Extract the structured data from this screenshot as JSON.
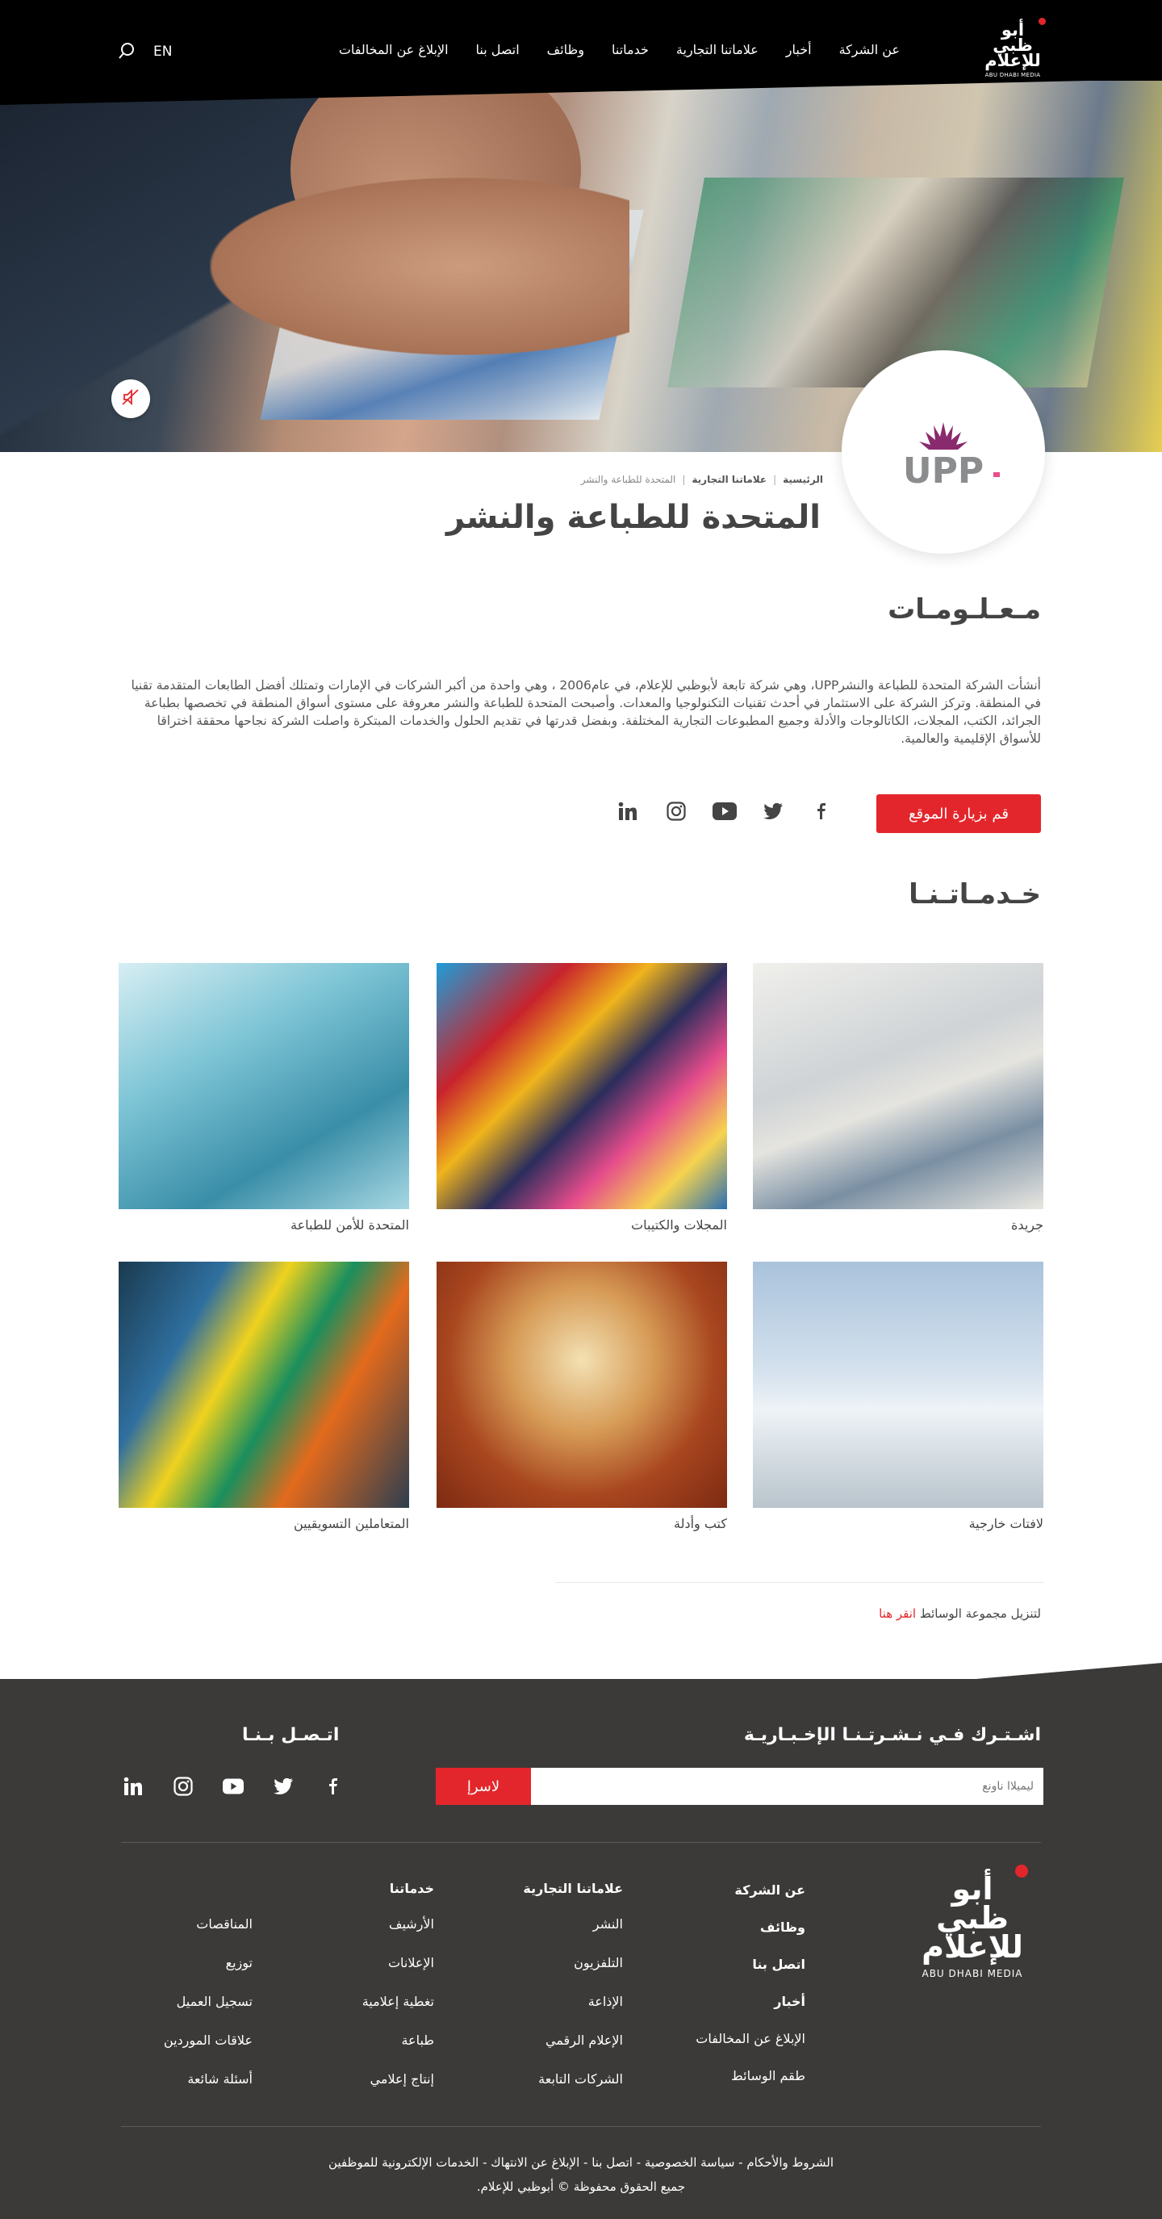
{
  "header": {
    "logo_text": "أبو ظبي للإعلام",
    "logo_sub": "ABU DHABI MEDIA",
    "nav": [
      "عن الشركة",
      "أخبار",
      "علاماتنا التجارية",
      "خدماتنا",
      "وظائف",
      "اتصل بنا",
      "الإبلاغ عن المخالفات"
    ],
    "lang": "EN"
  },
  "brand": {
    "logo_text": "UPP"
  },
  "breadcrumb": [
    "الرئيسية",
    "علاماتنا التجارية",
    "المتحدة للطباعة والنشر"
  ],
  "page_title": "المتحدة للطباعة والنشر",
  "info": {
    "heading": "مـعـلـومـات",
    "text": "أنشأت الشركة المتحدة للطباعة والنشرUPP، وهي شركة تابعة لأبوظبي للإعلام، في عام2006 ، وهي واحدة من أكبر الشركات في الإمارات وتمتلك أفضل الطابعات المتقدمة تقنيا في المنطقة. وتركز الشركة على الاستثمار في أحدث تقنيات التكنولوجيا والمعدات. وأصبحت المتحدة للطباعة والنشر معروفة على مستوى أسواق المنطقة في تخصصها بطباعة الجرائد، الكتب، المجلات، الكاتالوجات والأدلة وجميع المطبوعات التجارية المختلفة. وبفضل قدرتها في تقديم الحلول والخدمات المبتكرة واصلت الشركة نجاحها محققة اختراقا للأسواق الإقليمية والعالمية.",
    "visit_button": "قم بزيارة الموقع"
  },
  "services": {
    "heading": "خـدمـاتـنـا",
    "items": [
      "جريدة",
      "المجلات والكتيبات",
      "المتحدة للأمن للطباعة",
      "لافتات خارجية",
      "كتب وأدلة",
      "المتعاملين التسويقيين"
    ]
  },
  "media_kit": {
    "text": "لتنزيل مجموعة الوسائط",
    "link": "انقر هنا"
  },
  "footer": {
    "newsletter_title": "اشـتـرك فـي نـشـرتـنـا الإخـبـاريـة",
    "newsletter_placeholder": "ليميلاا ناونع",
    "subscribe_button": "لاسرإ",
    "contact_title": "اتـصـل بـنـا",
    "logo_text": "أبو ظبي للإعلام",
    "logo_sub": "ABU DHABI MEDIA",
    "col1": [
      "عن الشركة",
      "وظائف",
      "اتصل بنا",
      "أخبار",
      "الإبلاغ عن المخالفات",
      "طقم الوسائط"
    ],
    "col2_title": "علاماتنا التجارية",
    "col2": [
      "النشر",
      "التلفزيون",
      "الإذاعة",
      "الإعلام الرقمي",
      "الشركات التابعة"
    ],
    "col3_title": "خدماتنا",
    "col3": [
      "الأرشيف",
      "الإعلانات",
      "تغطية إعلامية",
      "طباعة",
      "إنتاج إعلامي"
    ],
    "col4": [
      "المناقصات",
      "توزيع",
      "تسجيل العميل",
      "علاقات الموردين",
      "أسئلة شائعة"
    ],
    "legal_links": "الشروط والأحكام - سياسة الخصوصية - اتصل بنا - الإبلاغ عن الانتهاك - الخدمات الإلكترونية للموظفين",
    "copyright": "جميع الحقوق محفوظة © أبوظبي للإعلام."
  },
  "colors": {
    "accent": "#e3262b",
    "footer_bg": "#3b3a39",
    "header_bg": "#000000"
  }
}
